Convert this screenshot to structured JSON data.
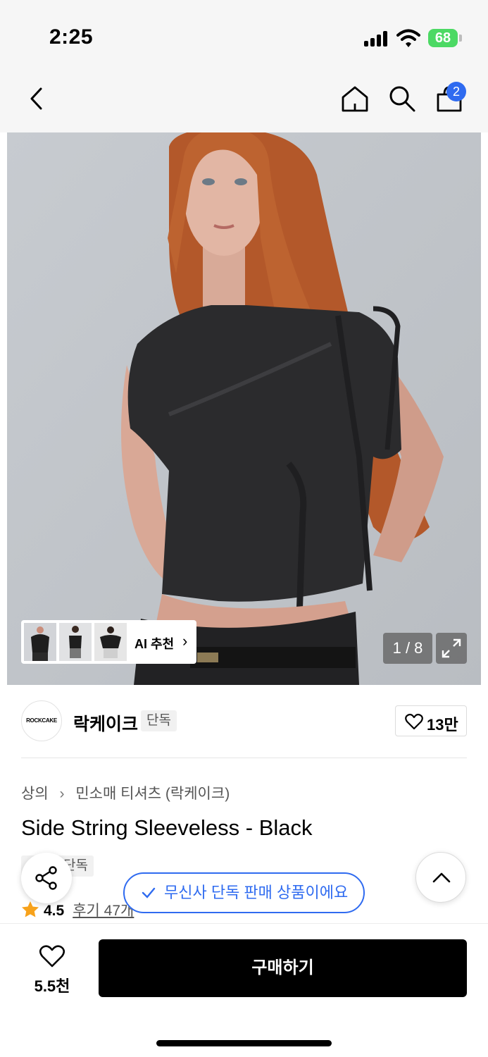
{
  "status_bar": {
    "time": "2:25",
    "battery": "68"
  },
  "nav": {
    "cart_count": "2"
  },
  "gallery": {
    "ai_label": "AI 추천",
    "counter": "1 / 8"
  },
  "brand": {
    "logo_text": "ROCKCAKE",
    "name": "락케이크",
    "tag": "단독",
    "likes": "13만"
  },
  "breadcrumb": {
    "level1": "상의",
    "level2": "민소매 티셔츠 (락케이크)"
  },
  "product": {
    "title": "Side String Sleeveless - Black",
    "exclusive_tag": "단독",
    "rating": "4.5",
    "reviews": "후기 47개"
  },
  "toast": {
    "text": "무신사 단독 판매 상품이에요"
  },
  "bottom": {
    "wish_count": "5.5천",
    "buy_label": "구매하기"
  },
  "colors": {
    "accent_blue": "#2f6bf0",
    "star": "#f7a21b",
    "battery_green": "#4cd964"
  }
}
